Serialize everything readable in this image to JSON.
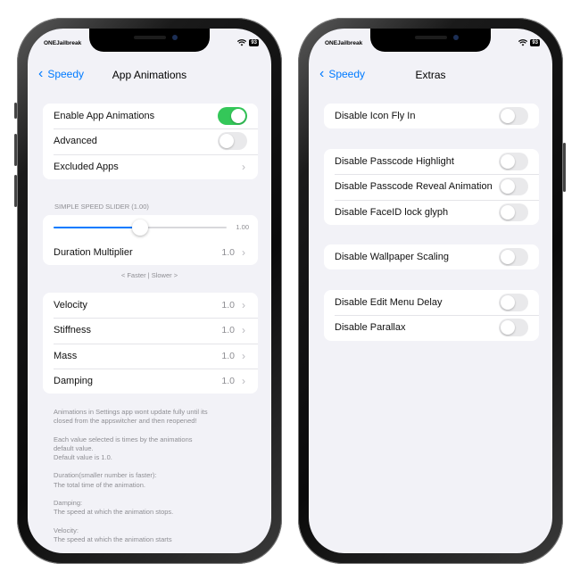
{
  "left": {
    "status": {
      "carrier": "ONEJailbreak",
      "battery": "93"
    },
    "nav": {
      "back_label": "Speedy",
      "title": "App Animations"
    },
    "group1": [
      {
        "label": "Enable App Animations",
        "toggle": true
      },
      {
        "label": "Advanced",
        "toggle": false
      },
      {
        "label": "Excluded Apps"
      }
    ],
    "slider_section_label": "SIMPLE SPEED SLIDER (1.00)",
    "slider": {
      "value": 0.5,
      "value_label": "1.00"
    },
    "duration_row": {
      "label": "Duration Multiplier",
      "value": "1.0"
    },
    "faster_slower_note": "< Faster | Slower >",
    "group3": [
      {
        "label": "Velocity",
        "value": "1.0"
      },
      {
        "label": "Stiffness",
        "value": "1.0"
      },
      {
        "label": "Mass",
        "value": "1.0"
      },
      {
        "label": "Damping",
        "value": "1.0"
      }
    ],
    "footer_lines": [
      "Animations in Settings app wont update fully until its",
      "closed from the appswitcher and then reopened!",
      "",
      "Each value selected is times by the animations",
      "default value.",
      "Default value is 1.0.",
      "",
      "Duration(smaller number is faster):",
      "The total time of the animation.",
      "",
      "Damping:",
      "The speed at which the animation stops.",
      "",
      "Velocity:",
      "The speed at which the animation starts"
    ]
  },
  "right": {
    "status": {
      "carrier": "ONEJailbreak",
      "battery": "93"
    },
    "nav": {
      "back_label": "Speedy",
      "title": "Extras"
    },
    "groups": [
      [
        {
          "label": "Disable Icon Fly In",
          "toggle": false
        }
      ],
      [
        {
          "label": "Disable Passcode Highlight",
          "toggle": false
        },
        {
          "label": "Disable Passcode Reveal Animation",
          "toggle": false
        },
        {
          "label": "Disable FaceID lock glyph",
          "toggle": false
        }
      ],
      [
        {
          "label": "Disable Wallpaper Scaling",
          "toggle": false
        }
      ],
      [
        {
          "label": "Disable Edit Menu Delay",
          "toggle": false
        },
        {
          "label": "Disable Parallax",
          "toggle": false
        }
      ]
    ]
  },
  "colors": {
    "accent": "#007aff",
    "toggle_on": "#34c759",
    "background": "#f2f2f7"
  }
}
